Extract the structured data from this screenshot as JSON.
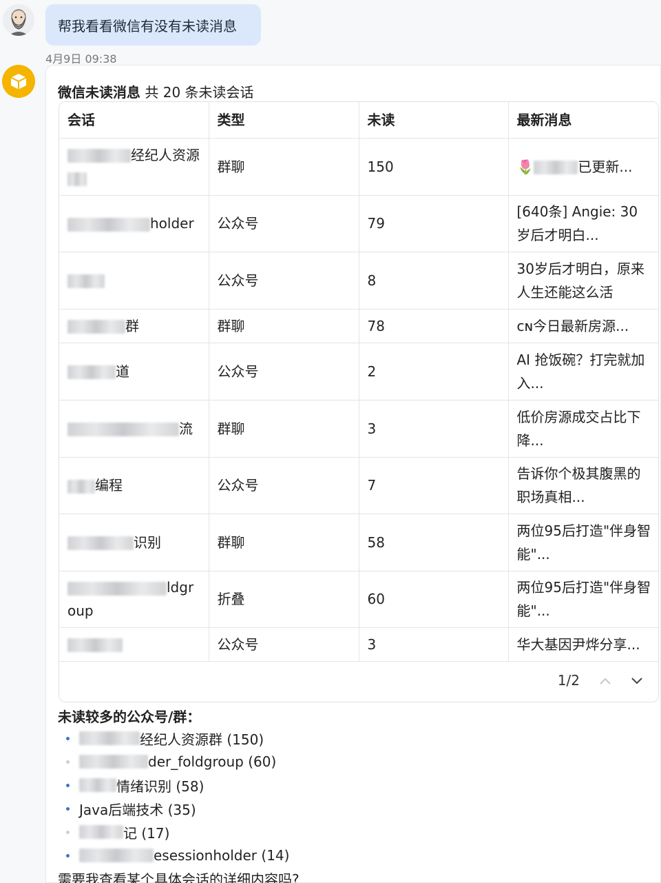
{
  "user_message": {
    "text": "帮我看看微信有没有未读消息",
    "timestamp": "4月9日 09:38"
  },
  "bot_message": {
    "title_bold": "微信未读消息",
    "title_rest": " 共 20 条未读会话",
    "table": {
      "headers": [
        "会话",
        "类型",
        "未读",
        "最新消息"
      ],
      "rows": [
        {
          "name": "经纪人资源",
          "type": "群聊",
          "unread": "150",
          "latest": "已更新..."
        },
        {
          "name": "holder",
          "type": "公众号",
          "unread": "79",
          "latest": "[640条] Angie: 30岁后才明白..."
        },
        {
          "name": "",
          "type": "公众号",
          "unread": "8",
          "latest": "30岁后才明白，原来人生还能这么活"
        },
        {
          "name": "群",
          "type": "群聊",
          "unread": "78",
          "latest": "ᴄɴ今日最新房源..."
        },
        {
          "name": "道",
          "type": "公众号",
          "unread": "2",
          "latest": "AI 抢饭碗？打完就加入..."
        },
        {
          "name": "流",
          "type": "群聊",
          "unread": "3",
          "latest": "低价房源成交占比下降..."
        },
        {
          "name": "编程",
          "type": "公众号",
          "unread": "7",
          "latest": "告诉你个极其腹黑的职场真相..."
        },
        {
          "name": "识别",
          "type": "群聊",
          "unread": "58",
          "latest": "两位95后打造\"伴身智能\"..."
        },
        {
          "name": "ldgroup",
          "type": "折叠",
          "unread": "60",
          "latest": "两位95后打造\"伴身智能\"..."
        },
        {
          "name": "",
          "type": "公众号",
          "unread": "3",
          "latest": "华大基因尹烨分享..."
        }
      ]
    },
    "pagination": "1/2",
    "section_title": "未读较多的公众号/群：",
    "top_list": [
      "经纪人资源群 (150)",
      "der_foldgroup (60)",
      "情绪识别 (58)",
      "Java后端技术 (35)",
      "记 (17)",
      "esessionholder (14)"
    ],
    "followup": "需要我查看某个具体会话的详细内容吗?"
  },
  "colors": {
    "user_bubble": "#dbe8fb",
    "bot_avatar": "#f5b400",
    "bullet": "#3a74c9"
  },
  "icons": {
    "user_avatar": "bearded-man-avatar",
    "bot_avatar": "box-icon",
    "page_up": "chevron-up-icon",
    "page_down": "chevron-down-icon",
    "flower": "tulip-emoji"
  }
}
